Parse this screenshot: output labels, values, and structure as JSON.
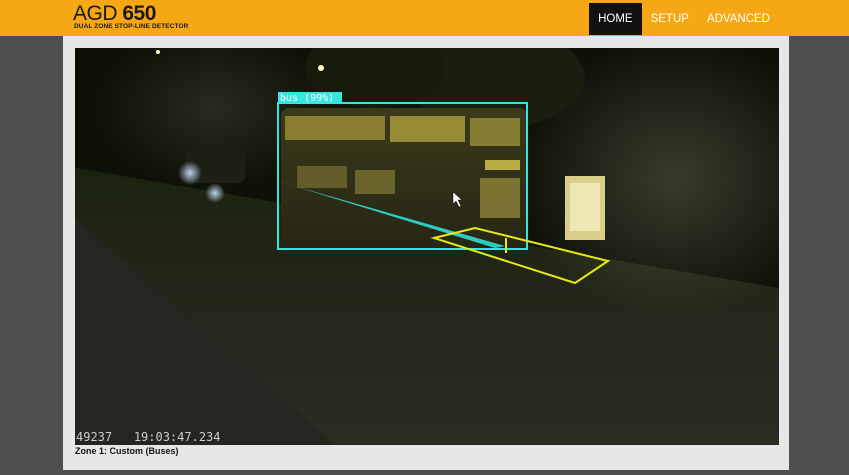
{
  "header": {
    "logo_prefix": "AGD",
    "logo_number": "650",
    "logo_subtitle": "DUAL ZONE STOP-LINE DETECTOR"
  },
  "nav": {
    "items": [
      {
        "label": "HOME",
        "active": true
      },
      {
        "label": "SETUP",
        "active": false
      },
      {
        "label": "ADVANCED",
        "active": false
      }
    ]
  },
  "video": {
    "detection_label": "bus (99%)",
    "frame_number": "49237",
    "timestamp": "19:03:47.234",
    "detection_color": "#33e6e0",
    "zone_color": "#e8e817"
  },
  "zone": {
    "caption": "Zone 1: Custom (Buses)"
  },
  "colors": {
    "accent": "#f5a814",
    "nav_active_bg": "#111111",
    "page_bg": "#4f4f4f"
  }
}
